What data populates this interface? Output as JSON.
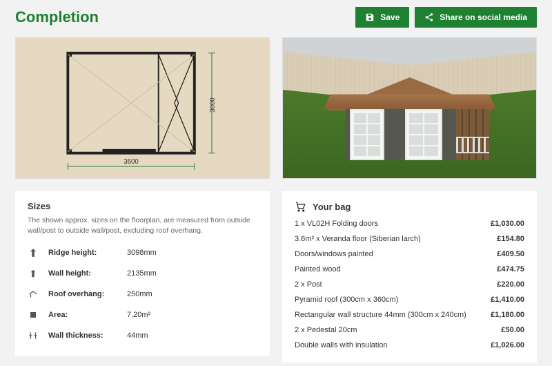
{
  "page": {
    "title": "Completion"
  },
  "actions": {
    "save": "Save",
    "share": "Share on social media"
  },
  "floorplan": {
    "width_label": "3600",
    "depth_label": "3000"
  },
  "sizes": {
    "heading": "Sizes",
    "note": "The shown approx. sizes on the floorplan, are measured from outside wall/post to outside wall/post, excluding roof overhang.",
    "rows": [
      {
        "label": "Ridge height:",
        "value": "3098mm"
      },
      {
        "label": "Wall height:",
        "value": "2135mm"
      },
      {
        "label": "Roof overhang:",
        "value": "250mm"
      },
      {
        "label": "Area:",
        "value": "7.20m²"
      },
      {
        "label": "Wall thickness:",
        "value": "44mm"
      }
    ]
  },
  "bag": {
    "heading": "Your bag",
    "items": [
      {
        "name": "1 x VL02H Folding doors",
        "price": "£1,030.00"
      },
      {
        "name": "3.6m² x Veranda floor (Siberian larch)",
        "price": "£154.80"
      },
      {
        "name": "Doors/windows painted",
        "price": "£409.50"
      },
      {
        "name": "Painted wood",
        "price": "£474.75"
      },
      {
        "name": "2 x Post",
        "price": "£220.00"
      },
      {
        "name": "Pyramid roof (300cm x 360cm)",
        "price": "£1,410.00"
      },
      {
        "name": "Rectangular wall structure 44mm (300cm x 240cm)",
        "price": "£1,180.00"
      },
      {
        "name": "2 x Pedestal 20cm",
        "price": "£50.00"
      },
      {
        "name": "Double walls with insulation",
        "price": "£1,026.00"
      }
    ]
  }
}
